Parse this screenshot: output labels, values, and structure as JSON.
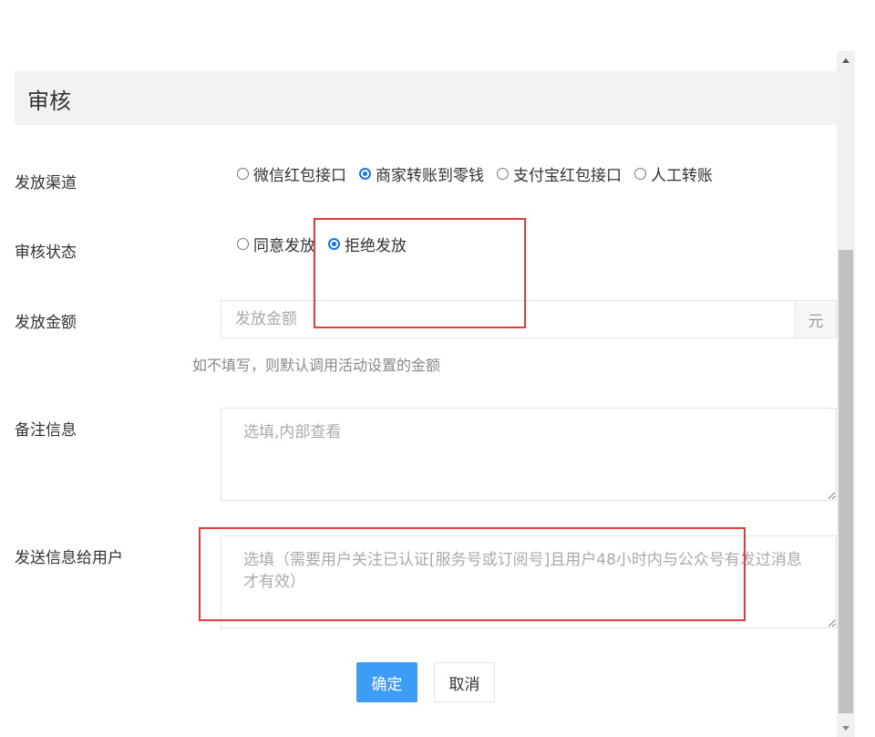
{
  "panel": {
    "title": "审核"
  },
  "fields": {
    "channel": {
      "label": "发放渠道",
      "options": [
        "微信红包接口",
        "商家转账到零钱",
        "支付宝红包接口",
        "人工转账"
      ],
      "selected": "商家转账到零钱"
    },
    "status": {
      "label": "审核状态",
      "options": [
        "同意发放",
        "拒绝发放"
      ],
      "selected": "拒绝发放"
    },
    "amount": {
      "label": "发放金额",
      "placeholder": "发放金额",
      "value": "",
      "unit": "元",
      "help": "如不填写，则默认调用活动设置的金额"
    },
    "remark": {
      "label": "备注信息",
      "placeholder": "选填,内部查看",
      "value": ""
    },
    "message": {
      "label": "发送信息给用户",
      "placeholder": "选填（需要用户关注已认证[服务号或订阅号]且用户48小时内与公众号有发过消息才有效）",
      "value": ""
    }
  },
  "buttons": {
    "confirm": "确定",
    "cancel": "取消"
  },
  "colors": {
    "primary": "#3d9cf5",
    "annotation": "#e03c3c",
    "header_bg": "#f2f2f2"
  }
}
